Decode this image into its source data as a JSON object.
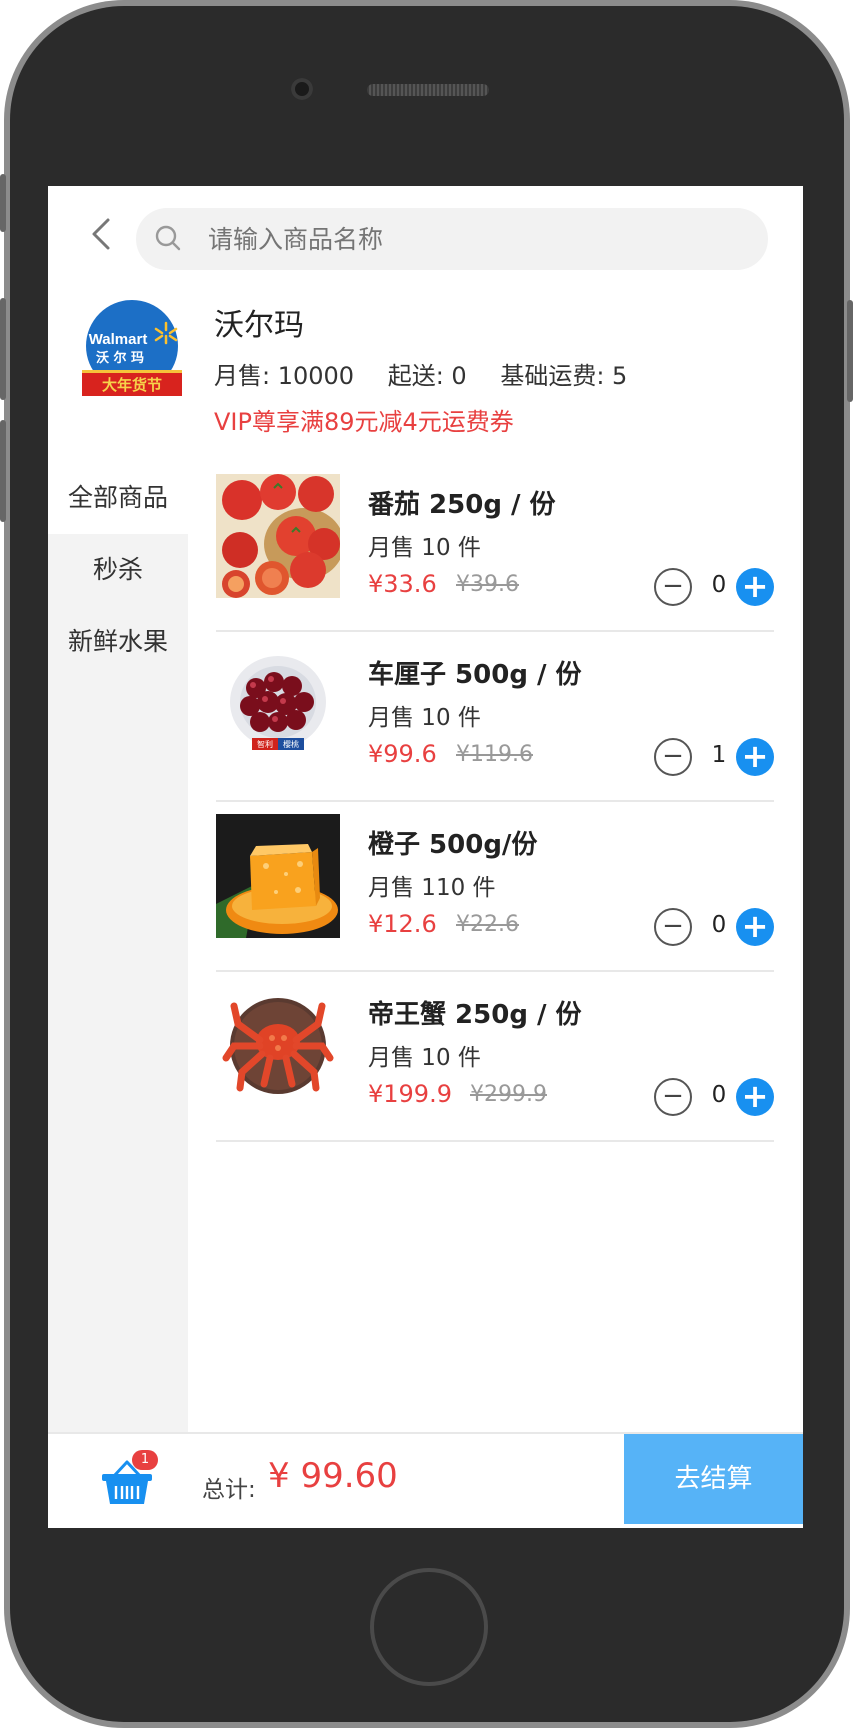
{
  "search": {
    "placeholder": "请输入商品名称"
  },
  "store": {
    "logo_text": "Walmart 沃尔玛 大年货节",
    "name": "沃尔玛",
    "monthly_sales": "月售: 10000",
    "min_order": "起送: 0",
    "delivery_fee": "基础运费: 5",
    "promo": "VIP尊享满89元减4元运费券"
  },
  "sidebar": {
    "items": [
      {
        "label": "全部商品",
        "active": true
      },
      {
        "label": "秒杀",
        "active": false
      },
      {
        "label": "新鲜水果",
        "active": false
      }
    ]
  },
  "products": [
    {
      "name": "番茄 250g / 份",
      "sales": "月售 10 件",
      "price": "¥33.6",
      "old_price": "¥39.6",
      "qty": "0",
      "image": "tomato"
    },
    {
      "name": "车厘子 500g / 份",
      "sales": "月售 10 件",
      "price": "¥99.6",
      "old_price": "¥119.6",
      "qty": "1",
      "image": "cherry"
    },
    {
      "name": "橙子 500g/份",
      "sales": "月售 110 件",
      "price": "¥12.6",
      "old_price": "¥22.6",
      "qty": "0",
      "image": "orange"
    },
    {
      "name": "帝王蟹 250g / 份",
      "sales": "月售 10 件",
      "price": "¥199.9",
      "old_price": "¥299.9",
      "qty": "0",
      "image": "king-crab"
    }
  ],
  "cart": {
    "badge": "1",
    "total_label": "总计:",
    "total_value": "¥ 99.60",
    "checkout_label": "去结算"
  },
  "colors": {
    "accent": "#1890f0",
    "price": "#e84040",
    "checkout": "#56b3f7"
  }
}
